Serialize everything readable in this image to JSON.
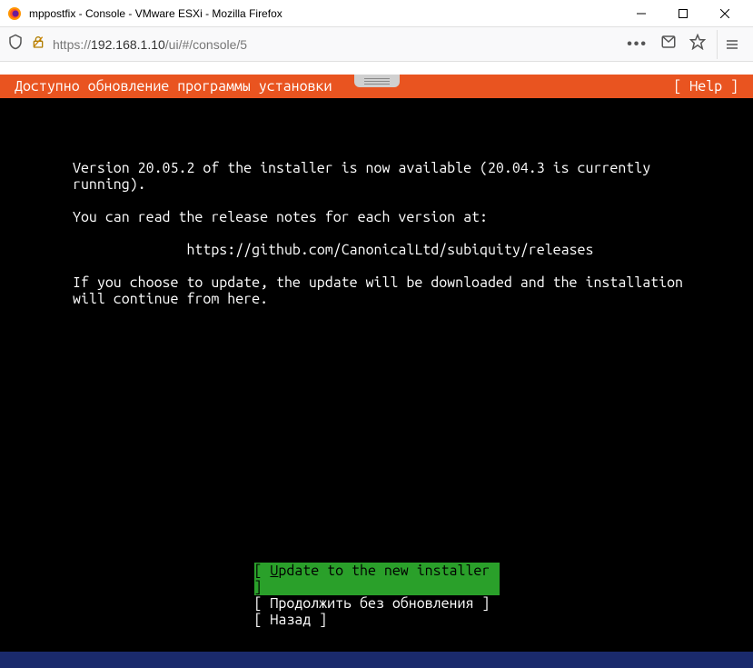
{
  "window": {
    "title": "mppostfix - Console - VMware ESXi - Mozilla Firefox"
  },
  "browser": {
    "url_prefix": "https://",
    "url_host": "192.168.1.10",
    "url_path": "/ui/#/console/5"
  },
  "installer": {
    "header_title": "  Доступно обновление программы установки",
    "header_help": "[ Help ]",
    "body_line1": "Version 20.05.2 of the installer is now available (20.04.3 is currently running).",
    "body_line2": "You can read the release notes for each version at:",
    "body_url": "https://github.com/CanonicalLtd/subiquity/releases",
    "body_line3": "If you choose to update, the update will be downloaded and the installation will continue from here.",
    "options": {
      "update": "[ Update to the new installer ]",
      "continue_label": "Продолжить без обновления",
      "back_label": "Назад"
    }
  }
}
